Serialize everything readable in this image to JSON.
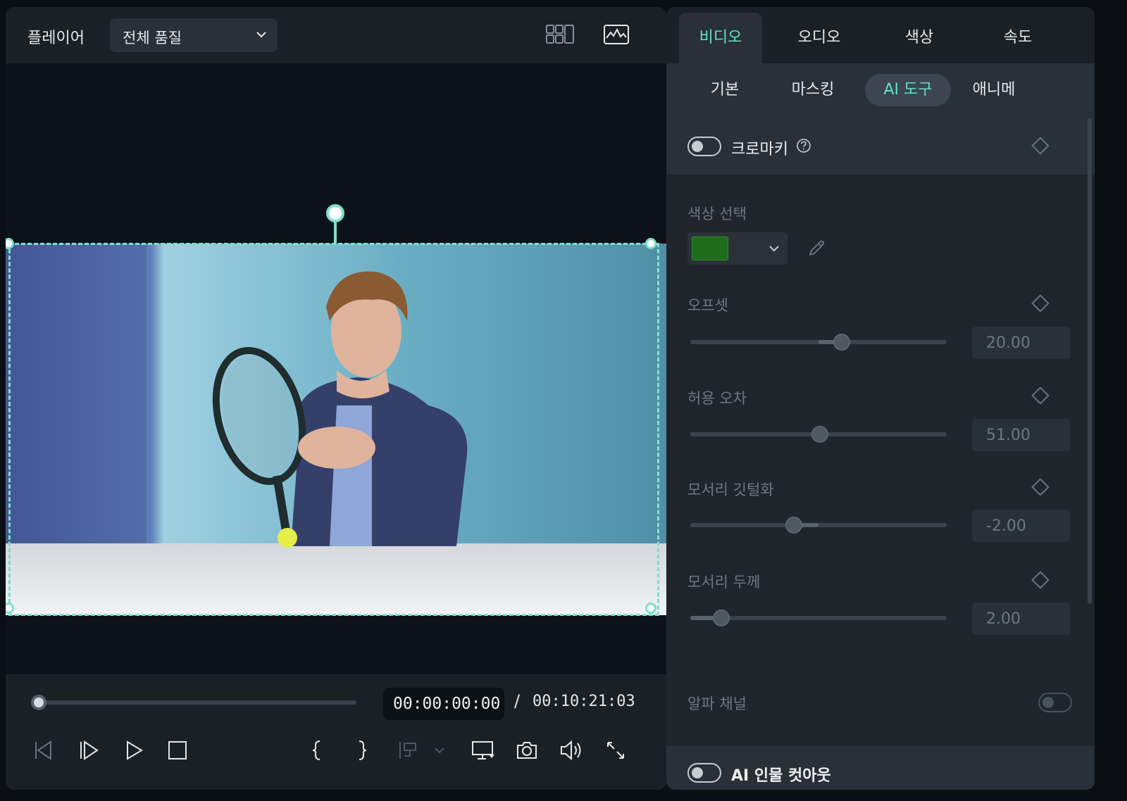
{
  "player": {
    "title": "플레이어",
    "quality": "전체 품질"
  },
  "transport": {
    "current_time": "00:00:00:00",
    "separator": "/",
    "total_time": "00:10:21:03",
    "progress": 0
  },
  "tabs": [
    {
      "label": "비디오",
      "active": true
    },
    {
      "label": "오디오",
      "active": false
    },
    {
      "label": "색상",
      "active": false
    },
    {
      "label": "속도",
      "active": false
    }
  ],
  "subtabs": [
    {
      "label": "기본",
      "active": false
    },
    {
      "label": "마스킹",
      "active": false
    },
    {
      "label": "AI 도구",
      "active": true
    },
    {
      "label": "애니메",
      "active": false
    }
  ],
  "chroma": {
    "label": "크로마키",
    "enabled": false,
    "color_label": "색상 선택",
    "color": "#1d6d1c",
    "params": [
      {
        "label": "오프셋",
        "value": "20.00",
        "fraction": 0.59
      },
      {
        "label": "허용 오차",
        "value": "51.00",
        "fraction": 0.505
      },
      {
        "label": "모서리 깃털화",
        "value": "-2.00",
        "fraction": 0.405
      },
      {
        "label": "모서리 두께",
        "value": "2.00",
        "fraction": 0.12
      }
    ],
    "alpha_label": "알파 채널"
  },
  "cutout": {
    "label": "AI 인물 컷아웃",
    "enabled": false
  },
  "colors": {
    "accent": "#5fe3c7",
    "panel": "#1b2026"
  }
}
